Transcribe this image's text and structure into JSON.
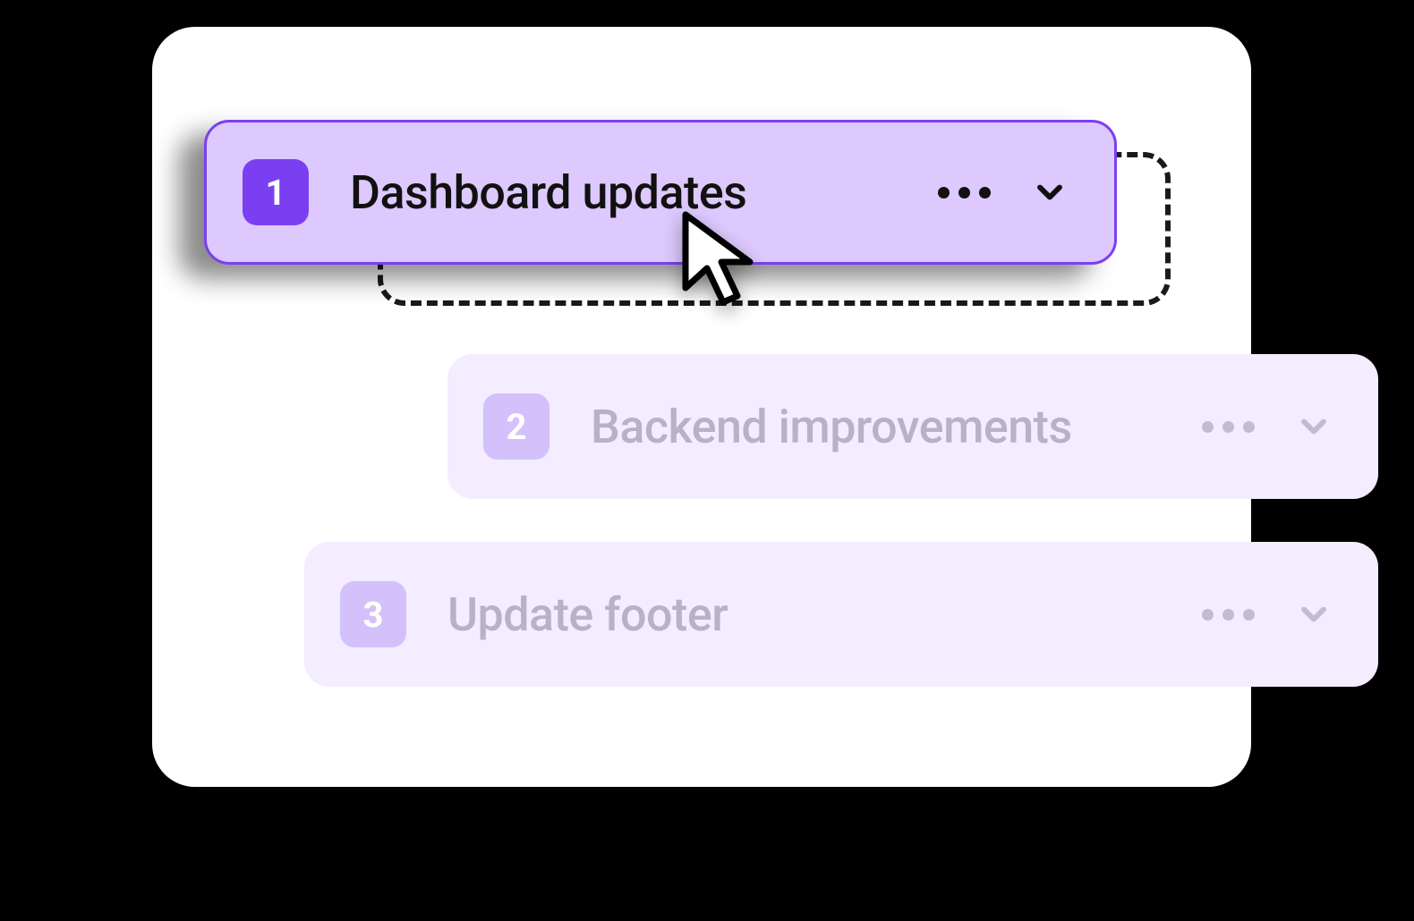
{
  "items": [
    {
      "number": "1",
      "title": "Dashboard updates",
      "state": "dragging"
    },
    {
      "number": "2",
      "title": "Backend improvements",
      "state": "muted"
    },
    {
      "number": "3",
      "title": "Update footer",
      "state": "muted"
    }
  ],
  "colors": {
    "accent": "#7b3ff2",
    "dragging_bg": "#ddc9fd",
    "muted_bg": "#f3edff",
    "badge_muted": "#d4c0fa",
    "muted_text": "#b9b1c7"
  }
}
